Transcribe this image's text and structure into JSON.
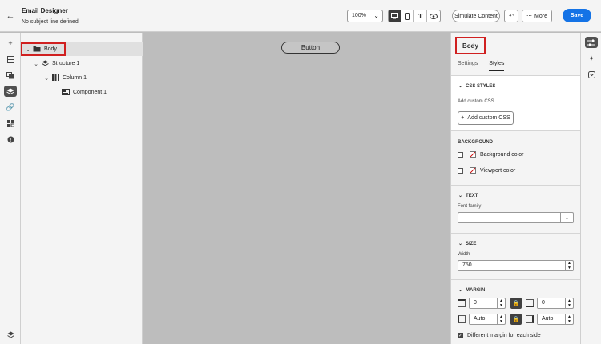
{
  "header": {
    "title": "Email Designer",
    "subtitle": "No subject line defined",
    "zoom": "100%",
    "simulate_label": "Simulate Content",
    "more_label": "More",
    "save_label": "Save"
  },
  "tree": {
    "items": [
      {
        "label": "Body"
      },
      {
        "label": "Structure 1"
      },
      {
        "label": "Column 1"
      },
      {
        "label": "Component 1"
      }
    ]
  },
  "canvas": {
    "button_label": "Button"
  },
  "props": {
    "title": "Body",
    "tabs": [
      "Settings",
      "Styles"
    ],
    "css": {
      "heading": "CSS STYLES",
      "hint": "Add custom CSS.",
      "button": "Add custom CSS"
    },
    "background": {
      "heading": "BACKGROUND",
      "bg_color": "Background color",
      "viewport_color": "Viewport color"
    },
    "text": {
      "heading": "TEXT",
      "font_family_label": "Font family"
    },
    "size": {
      "heading": "SIZE",
      "width_label": "Width",
      "width_value": "750"
    },
    "margin": {
      "heading": "MARGIN",
      "top": "0",
      "bottom": "0",
      "left": "Auto",
      "right": "Auto",
      "different_label": "Different margin for each side"
    }
  },
  "colors": {
    "accent": "#1473e6",
    "highlight": "#d02020"
  }
}
